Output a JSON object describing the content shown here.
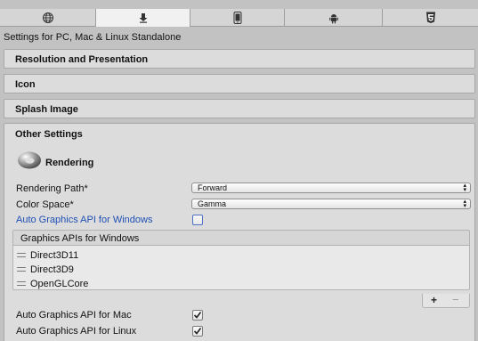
{
  "platform_tabs": [
    {
      "icon": "globe-icon",
      "active": false
    },
    {
      "icon": "download-icon",
      "active": true
    },
    {
      "icon": "mobile-phone-icon",
      "active": false
    },
    {
      "icon": "android-icon",
      "active": false
    },
    {
      "icon": "html5-icon",
      "active": false
    }
  ],
  "header": {
    "title": "Settings for PC, Mac & Linux Standalone"
  },
  "sections": {
    "resolution": "Resolution and Presentation",
    "icon": "Icon",
    "splash": "Splash Image",
    "other": "Other Settings"
  },
  "rendering": {
    "heading": "Rendering",
    "rendering_path_label": "Rendering Path*",
    "rendering_path_value": "Forward",
    "color_space_label": "Color Space*",
    "color_space_value": "Gamma",
    "auto_api_windows_label": "Auto Graphics API for Windows",
    "auto_api_windows_checked": false,
    "graphics_apis_header": "Graphics APIs for Windows",
    "graphics_apis": [
      "Direct3D11",
      "Direct3D9",
      "OpenGLCore"
    ],
    "list_add": "+",
    "list_remove": "−",
    "auto_api_mac_label": "Auto Graphics API for Mac",
    "auto_api_mac_checked": true,
    "auto_api_linux_label": "Auto Graphics API for Linux",
    "auto_api_linux_checked": true
  },
  "colors": {
    "link_blue": "#1f4fb5",
    "panel_bg": "#dcdcdc",
    "active_tab": "#f1f1f1"
  }
}
